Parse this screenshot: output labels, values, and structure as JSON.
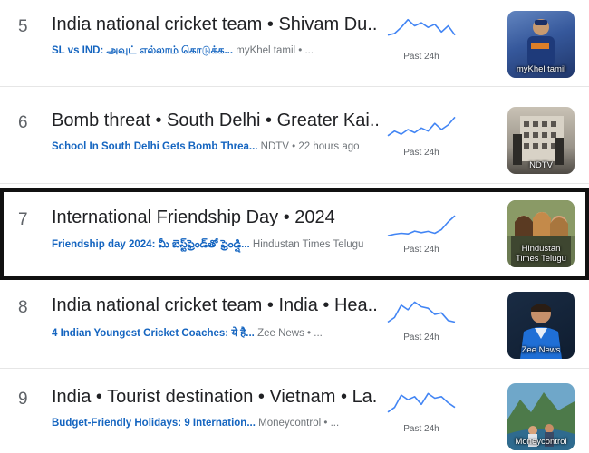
{
  "trends": [
    {
      "rank": "5",
      "title": "India national cricket team • Shivam Du...",
      "article": "SL vs IND: அவுட் எல்லாம் கொடுக்க...",
      "source": "myKhel tamil • ...",
      "timeframe": "Past 24h",
      "thumb_caption": "myKhel tamil",
      "sparkline": [
        0.55,
        0.5,
        0.3,
        0.05,
        0.25,
        0.15,
        0.3,
        0.2,
        0.45,
        0.25,
        0.55
      ],
      "selected": false
    },
    {
      "rank": "6",
      "title": "Bomb threat • South Delhi • Greater Kai...",
      "article": "School In South Delhi Gets Bomb Threa...",
      "source": "NDTV • 22 hours ago",
      "timeframe": "Past 24h",
      "thumb_caption": "NDTV",
      "sparkline": [
        0.7,
        0.55,
        0.65,
        0.5,
        0.6,
        0.45,
        0.55,
        0.3,
        0.5,
        0.35,
        0.1
      ],
      "selected": false
    },
    {
      "rank": "7",
      "title": "International Friendship Day • 2024",
      "article": "Friendship day 2024: మీ బెస్ట్‌ఫ్రెండ్‌తో ఫ్రెండ్షి...",
      "source": "Hindustan Times Telugu",
      "timeframe": "Past 24h",
      "thumb_caption": "Hindustan Times Telugu",
      "sparkline": [
        0.8,
        0.75,
        0.72,
        0.74,
        0.65,
        0.7,
        0.66,
        0.72,
        0.6,
        0.35,
        0.15
      ],
      "selected": true
    },
    {
      "rank": "8",
      "title": "India national cricket team • India • Hea...",
      "article": "4 Indian Youngest Cricket Coaches: ये है...",
      "source": "Zee News • ...",
      "timeframe": "Past 24h",
      "thumb_caption": "Zee News",
      "sparkline": [
        0.75,
        0.6,
        0.2,
        0.35,
        0.1,
        0.25,
        0.3,
        0.5,
        0.45,
        0.7,
        0.75
      ],
      "selected": false
    },
    {
      "rank": "9",
      "title": "India • Tourist destination • Vietnam • La...",
      "article": "Budget-Friendly Holidays: 9 Internation...",
      "source": "Moneycontrol • ...",
      "timeframe": "Past 24h",
      "thumb_caption": "Moneycontrol",
      "sparkline": [
        0.7,
        0.55,
        0.15,
        0.3,
        0.2,
        0.45,
        0.1,
        0.25,
        0.2,
        0.4,
        0.55
      ],
      "selected": false
    }
  ],
  "colors": {
    "selected_border": "#111111",
    "sparkline": "#4285f4",
    "article_link": "#1565c0"
  },
  "icons": {
    "thumb_5": "cricketer-photo",
    "thumb_6": "building-photo",
    "thumb_7": "friends-photo",
    "thumb_8": "coach-photo",
    "thumb_9": "travel-photo"
  }
}
